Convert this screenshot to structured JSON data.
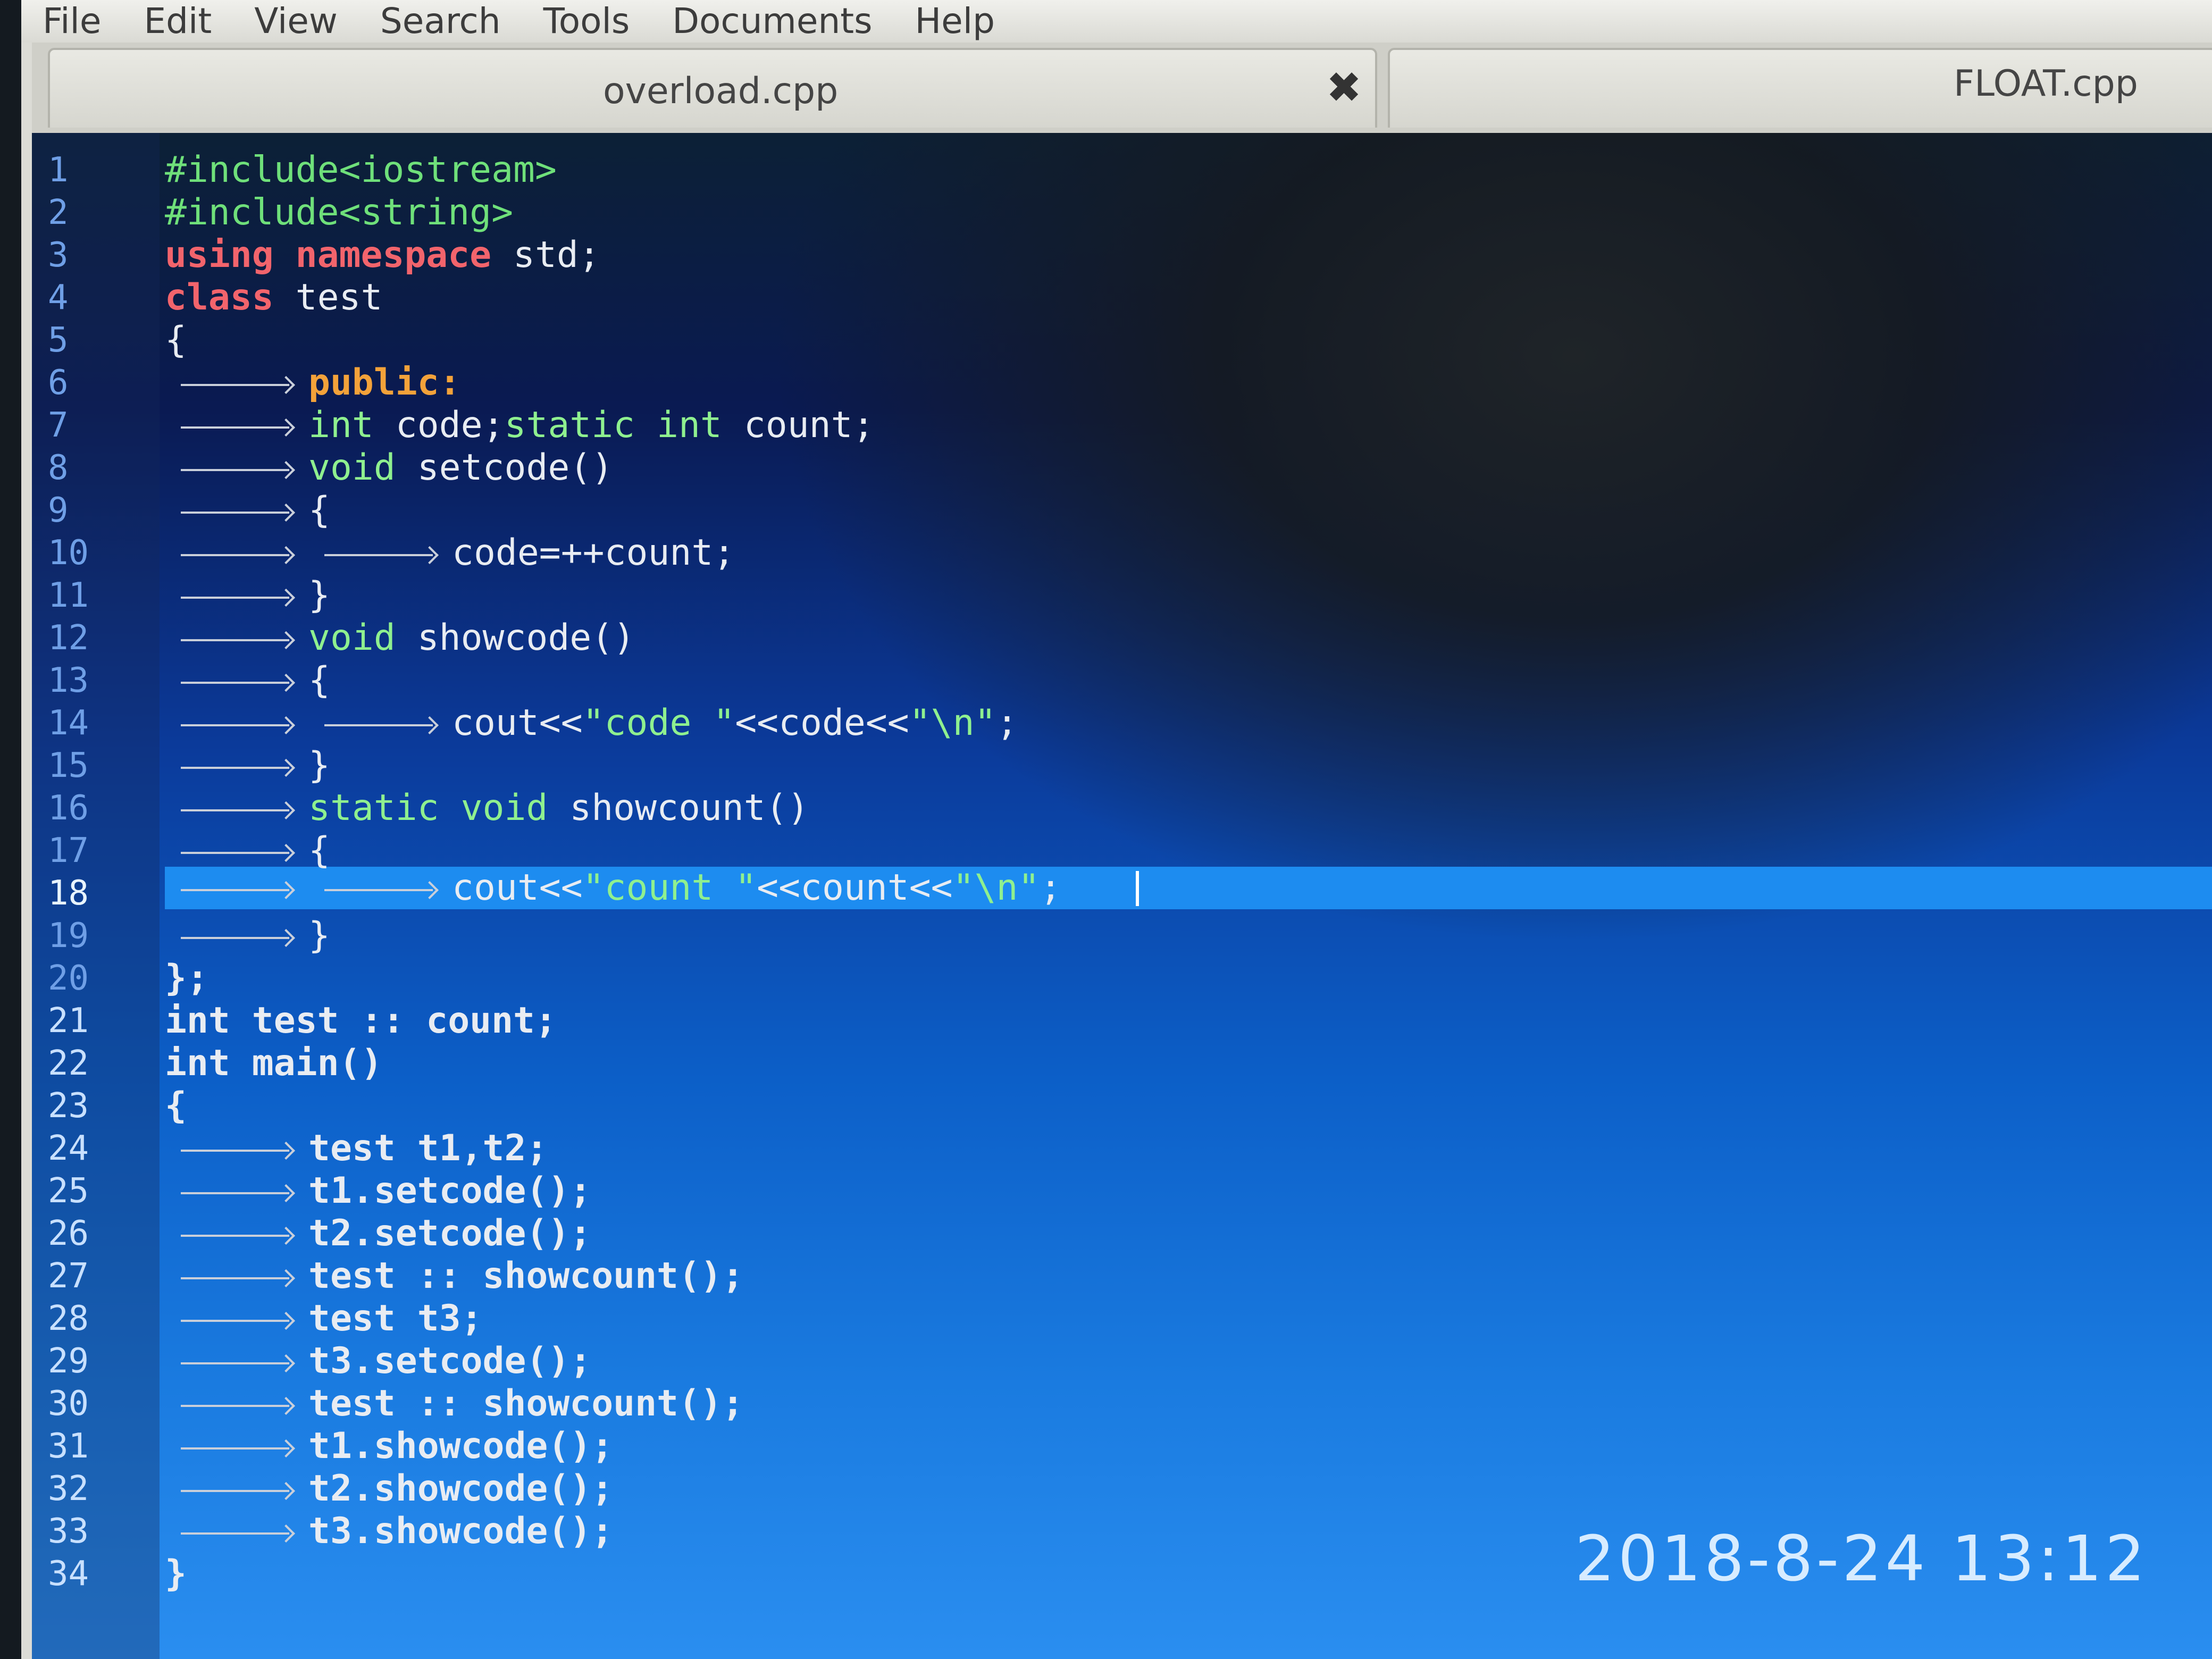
{
  "menu": [
    "File",
    "Edit",
    "View",
    "Search",
    "Tools",
    "Documents",
    "Help"
  ],
  "tabs": [
    {
      "label": "overload.cpp",
      "close": "✖"
    },
    {
      "label": "FLOAT.cpp"
    }
  ],
  "line_numbers": [
    "1",
    "2",
    "3",
    "4",
    "5",
    "6",
    "7",
    "8",
    "9",
    "10",
    "11",
    "12",
    "13",
    "14",
    "15",
    "16",
    "17",
    "18",
    "19",
    "20",
    "21",
    "22",
    "23",
    "24",
    "25",
    "26",
    "27",
    "28",
    "29",
    "30",
    "31",
    "32",
    "33",
    "34"
  ],
  "code": {
    "l1": "#include<iostream>",
    "l2": "#include<string>",
    "l3a": "using namespace",
    "l3b": " std;",
    "l4a": "class",
    "l4b": " test",
    "l5": "{",
    "l6": "public:",
    "l7a": "int",
    "l7b": " code;",
    "l7c": "static int",
    "l7d": " count;",
    "l8a": "void",
    "l8b": " setcode()",
    "l9": "{",
    "l10": "code=++count;",
    "l11": "}",
    "l12a": "void",
    "l12b": " showcode()",
    "l13": "{",
    "l14a": "cout<<",
    "l14b": "\"code \"",
    "l14c": "<<code<<",
    "l14d": "\"\\n\"",
    "l14e": ";",
    "l15": "}",
    "l16a": "static void",
    "l16b": " showcount()",
    "l17": "{",
    "l18a": "cout<<",
    "l18b": "\"count \"",
    "l18c": "<<count<<",
    "l18d": "\"\\n\"",
    "l18e": ";",
    "l19": "}",
    "l20": "};",
    "l21": "int test :: count;",
    "l22": "int main()",
    "l23": "{",
    "l24": "test t1,t2;",
    "l25": "t1.setcode();",
    "l26": "t2.setcode();",
    "l27": "test :: showcount();",
    "l28": "test t3;",
    "l29": "t3.setcode();",
    "l30": "test :: showcount();",
    "l31": "t1.showcode();",
    "l32": "t2.showcode();",
    "l33": "t3.showcode();",
    "l34": "}"
  },
  "timestamp": "2018-8-24 13:12",
  "colors": {
    "highlight": "#1d8cf0",
    "keyword": "#f2646c",
    "preprocessor": "#6fe07a",
    "access": "#f3a23a"
  }
}
